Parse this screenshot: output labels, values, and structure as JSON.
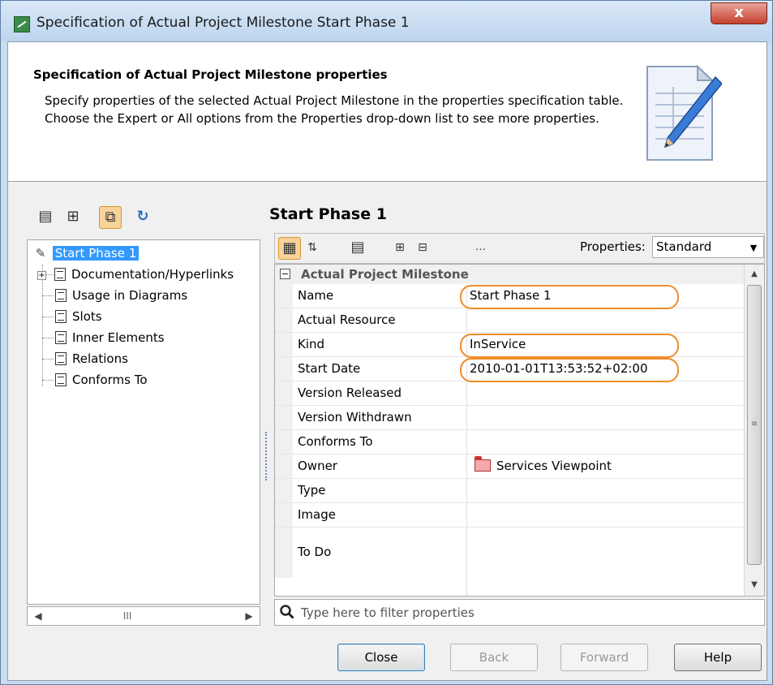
{
  "window": {
    "title": "Specification of Actual Project Milestone Start Phase 1",
    "close_glyph": "x"
  },
  "header": {
    "title": "Specification of Actual Project Milestone properties",
    "description": "Specify properties of the selected Actual Project Milestone in the properties specification table. Choose the Expert or All options from the Properties drop-down list to see more properties."
  },
  "tree": {
    "root": "Start Phase 1",
    "items": [
      "Documentation/Hyperlinks",
      "Usage in Diagrams",
      "Slots",
      "Inner Elements",
      "Relations",
      "Conforms To"
    ]
  },
  "scrollbar_thumb_glyph": "III",
  "spec": {
    "title": "Start Phase 1",
    "properties_label": "Properties:",
    "properties_selected": "Standard",
    "group": "Actual Project Milestone",
    "rows": [
      {
        "name": "Name",
        "value": "Start Phase 1",
        "highlighted": true
      },
      {
        "name": "Actual Resource",
        "value": ""
      },
      {
        "name": "Kind",
        "value": "InService",
        "highlighted": true
      },
      {
        "name": "Start Date",
        "value": "2010-01-01T13:53:52+02:00",
        "highlighted": true
      },
      {
        "name": "Version Released",
        "value": ""
      },
      {
        "name": "Version Withdrawn",
        "value": ""
      },
      {
        "name": "Conforms To",
        "value": ""
      },
      {
        "name": "Owner",
        "value": "Services Viewpoint",
        "icon": "package-folder-icon"
      },
      {
        "name": "Type",
        "value": ""
      },
      {
        "name": "Image",
        "value": ""
      },
      {
        "name": "To Do",
        "value": ""
      }
    ],
    "filter_placeholder": "Type here to filter properties"
  },
  "buttons": {
    "close": "Close",
    "back": "Back",
    "forward": "Forward",
    "help": "Help"
  },
  "colors": {
    "highlight": "#f08c28",
    "selection": "#3399ff"
  }
}
